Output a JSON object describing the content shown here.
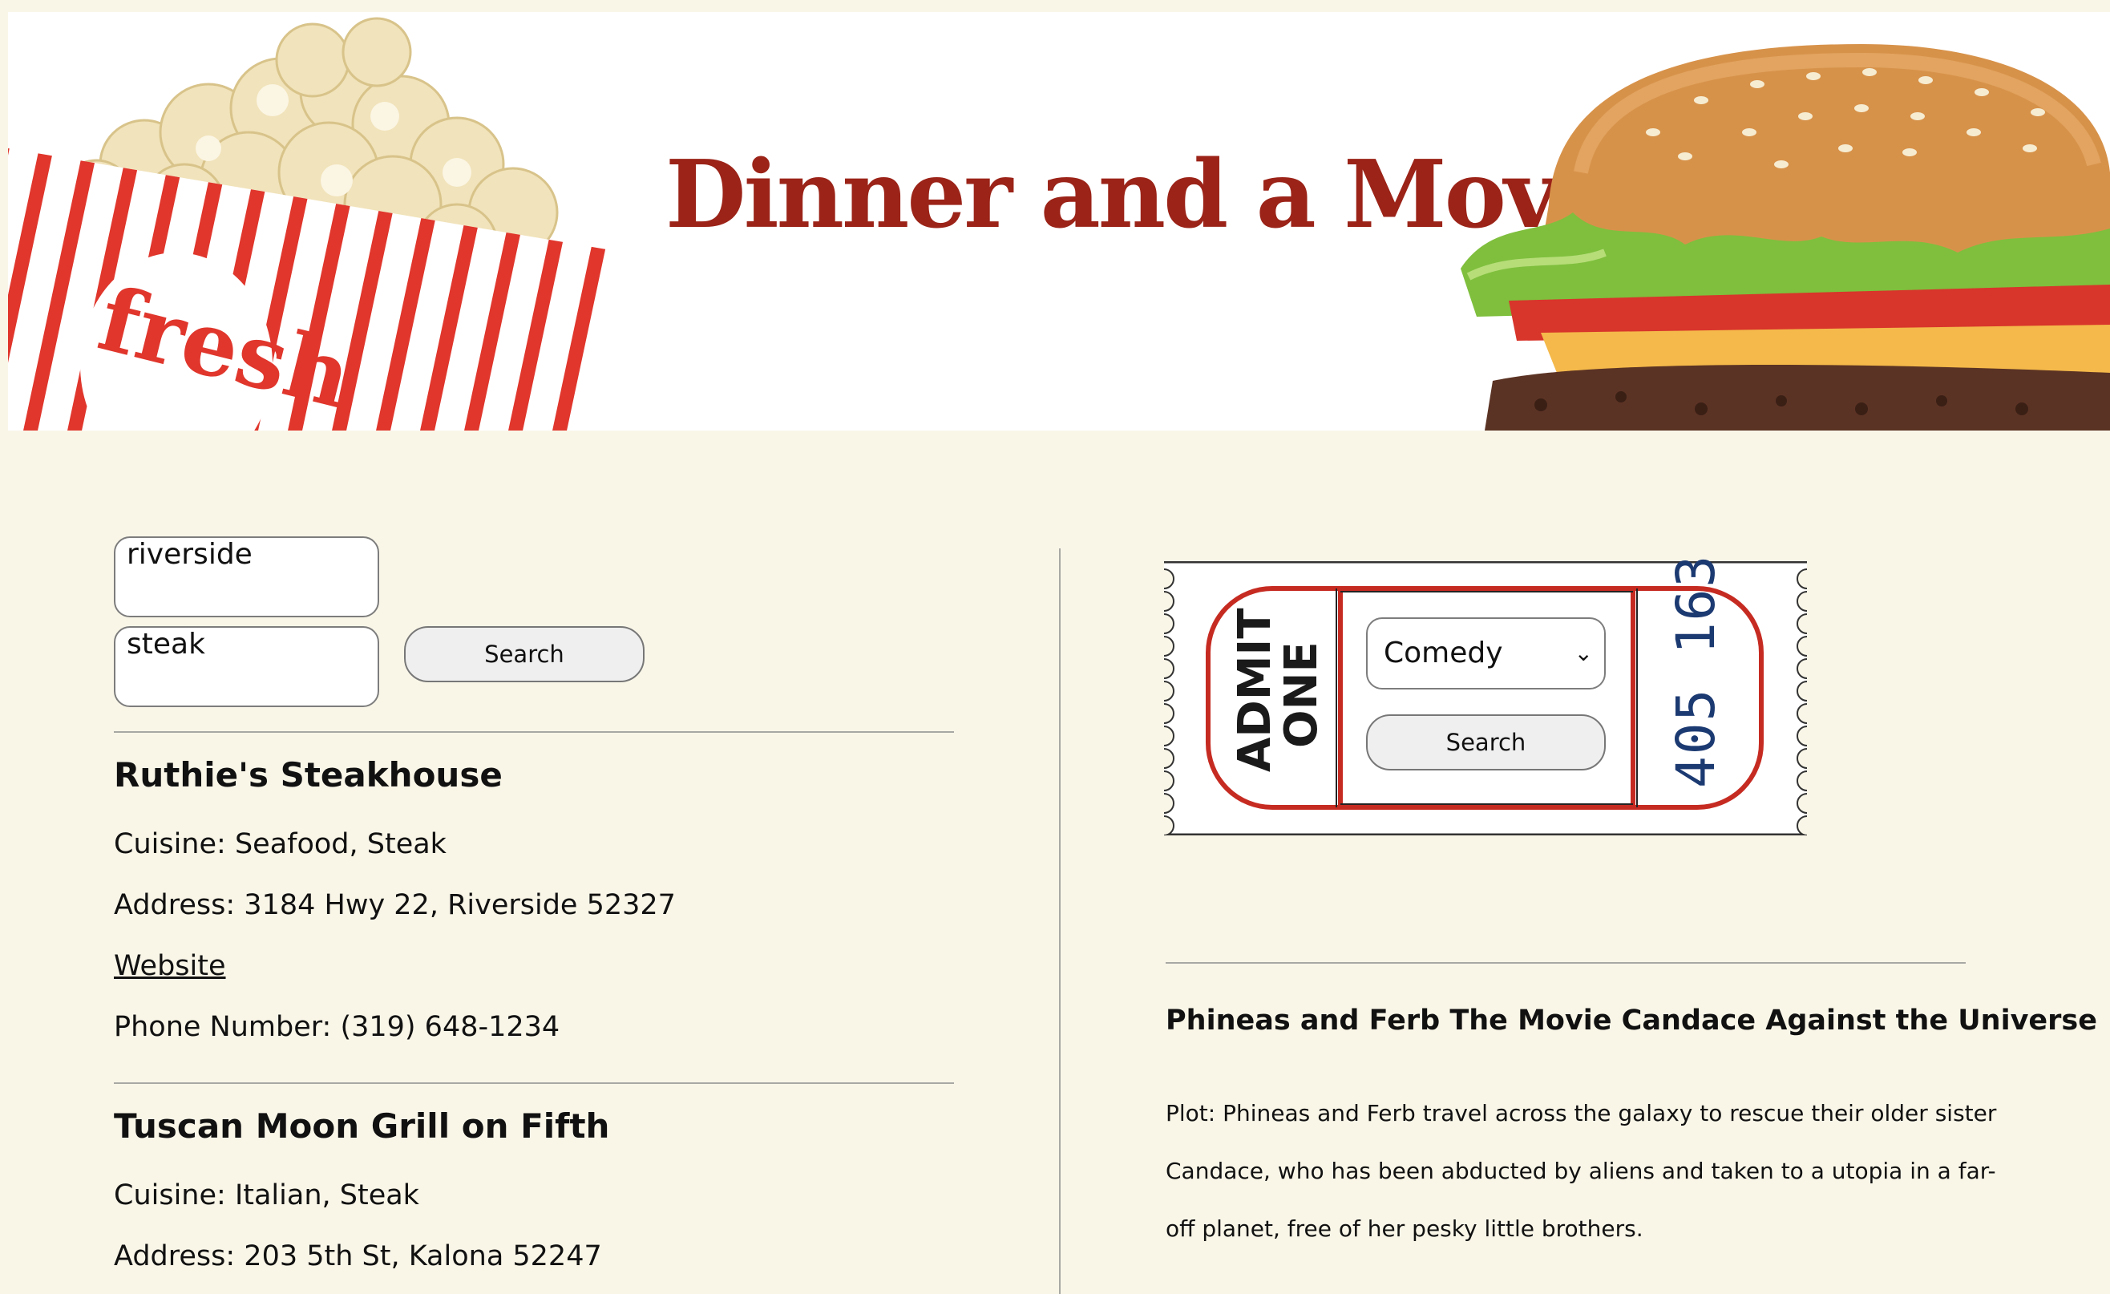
{
  "header": {
    "title": "Dinner and a Movie",
    "popcorn_label": "fresh"
  },
  "restaurant_search": {
    "location_value": "riverside",
    "food_value": "steak",
    "search_label": "Search"
  },
  "restaurants": [
    {
      "name": "Ruthie's Steakhouse",
      "cuisine": "Cuisine: Seafood, Steak",
      "address": "Address: 3184 Hwy 22, Riverside 52327",
      "website": "Website",
      "phone": "Phone Number: (319) 648-1234"
    },
    {
      "name": "Tuscan Moon Grill on Fifth",
      "cuisine": "Cuisine: Italian, Steak",
      "address": "Address: 203 5th St, Kalona 52247"
    }
  ],
  "ticket": {
    "admit_line1": "ADMIT",
    "admit_line2": "ONE",
    "serial": "405 163",
    "genre_selected": "Comedy",
    "search_label": "Search"
  },
  "movie": {
    "title": "Phineas and Ferb The Movie Candace Against the Universe",
    "plot_lines": [
      "Plot: Phineas and Ferb travel across the galaxy to rescue their older sister",
      "Candace, who has been abducted by aliens and taken to a utopia in a far-",
      "off planet, free of her pesky little brothers."
    ]
  },
  "colors": {
    "title_red": "#9b2318",
    "ticket_red": "#c62b22",
    "serial_blue": "#1c3a72",
    "background": "#f9f6e8"
  }
}
